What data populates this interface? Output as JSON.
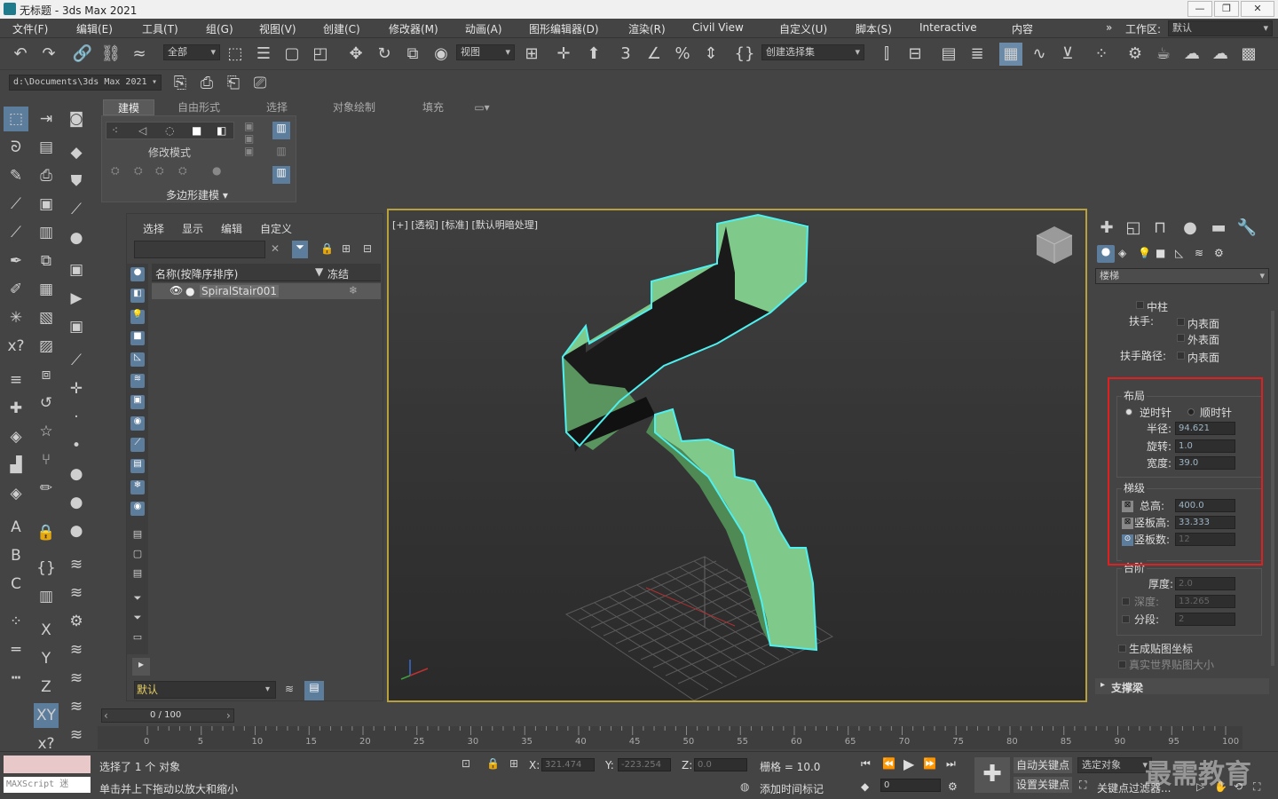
{
  "titlebar": {
    "title": "无标题 - 3ds Max 2021"
  },
  "menus": [
    "文件(F)",
    "编辑(E)",
    "工具(T)",
    "组(G)",
    "视图(V)",
    "创建(C)",
    "修改器(M)",
    "动画(A)",
    "图形编辑器(D)",
    "渲染(R)",
    "Civil View",
    "自定义(U)",
    "脚本(S)",
    "Interactive",
    "内容"
  ],
  "workspace": {
    "label": "工作区:",
    "value": "默认"
  },
  "toolbar": {
    "filter": "全部",
    "coord": "视图",
    "selset": "创建选择集"
  },
  "project_path": "d:\\Documents\\3ds Max 2021",
  "ribbon": {
    "tabs": [
      "建模",
      "自由形式",
      "选择",
      "对象绘制",
      "填充"
    ],
    "panel_label": "修改模式",
    "panel_footer": "多边形建模"
  },
  "scene": {
    "tabs": [
      "选择",
      "显示",
      "编辑",
      "自定义"
    ],
    "col_name": "名称(按降序排序)",
    "col_freeze": "冻结",
    "object": "SpiralStair001",
    "layer": "默认"
  },
  "viewport": {
    "label": "[+] [透视] [标准] [默认明暗处理]"
  },
  "command_panel": {
    "category": "楼梯",
    "center_pole": "中柱",
    "handrail": "扶手:",
    "handrail_path": "扶手路径:",
    "inside": "内表面",
    "outside": "外表面",
    "layout": {
      "title": "布局",
      "ccw": "逆时针",
      "cw": "顺时针",
      "radius_label": "半径:",
      "radius": "94.621",
      "revs_label": "旋转:",
      "revs": "1.0",
      "width_label": "宽度:",
      "width": "39.0"
    },
    "rise": {
      "title": "梯级",
      "overall_label": "总高:",
      "overall": "400.0",
      "riser_ht_label": "竖板高:",
      "riser_ht": "33.333",
      "riser_ct_label": "竖板数:",
      "riser_ct": "12"
    },
    "steps": {
      "title": "台阶",
      "thickness_label": "厚度:",
      "thickness": "2.0",
      "depth_label": "深度:",
      "depth": "13.265",
      "segments_label": "分段:",
      "segments": "2"
    },
    "gen_map": "生成贴图坐标",
    "real_world": "真实世界贴图大小",
    "support": "支撑梁"
  },
  "time": {
    "slider": "0 / 100",
    "ticks": [
      "0",
      "5",
      "10",
      "15",
      "20",
      "25",
      "30",
      "35",
      "40",
      "45",
      "50",
      "55",
      "60",
      "65",
      "70",
      "75",
      "80",
      "85",
      "90",
      "95",
      "100"
    ]
  },
  "status": {
    "selected": "选择了 1 个 对象",
    "prompt": "单击并上下拖动以放大和缩小",
    "x_label": "X:",
    "x": "321.474",
    "y_label": "Y:",
    "y": "-223.254",
    "z_label": "Z:",
    "z": "0.0",
    "grid": "栅格 = 10.0",
    "add_tag": "添加时间标记",
    "autokey": "自动关键点",
    "setkey": "设置关键点",
    "selobj": "选定对象",
    "keyfilter": "关键点过滤器...",
    "frame": "0",
    "maxscript": "MAXScript 迷"
  },
  "watermark": "最需教育"
}
